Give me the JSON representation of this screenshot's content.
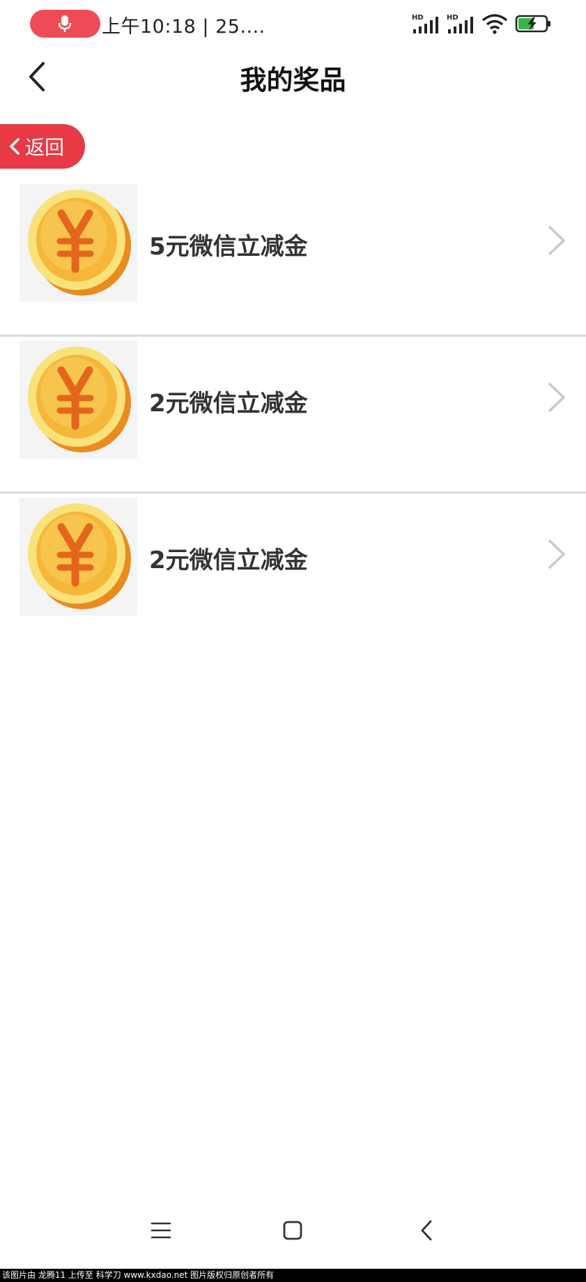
{
  "status_bar": {
    "time": "上午10:18 | 25....",
    "signal_1_label": "HD",
    "signal_2_label": "HD",
    "accent_color": "#ee4b57",
    "battery_color": "#3bb54a"
  },
  "header": {
    "title": "我的奖品"
  },
  "return_button": {
    "label": "返回",
    "color": "#e83a45"
  },
  "prizes": [
    {
      "name": "5元微信立减金",
      "icon": "yuan-coin-icon"
    },
    {
      "name": "2元微信立减金",
      "icon": "yuan-coin-icon"
    },
    {
      "name": "2元微信立减金",
      "icon": "yuan-coin-icon"
    }
  ],
  "nav_bar": {
    "icons": [
      "menu-icon",
      "home-icon",
      "back-icon"
    ]
  },
  "watermark": {
    "text": "该图片由 龙腾11 上传至 科学刀 www.kxdao.net 图片版权归原创者所有"
  }
}
